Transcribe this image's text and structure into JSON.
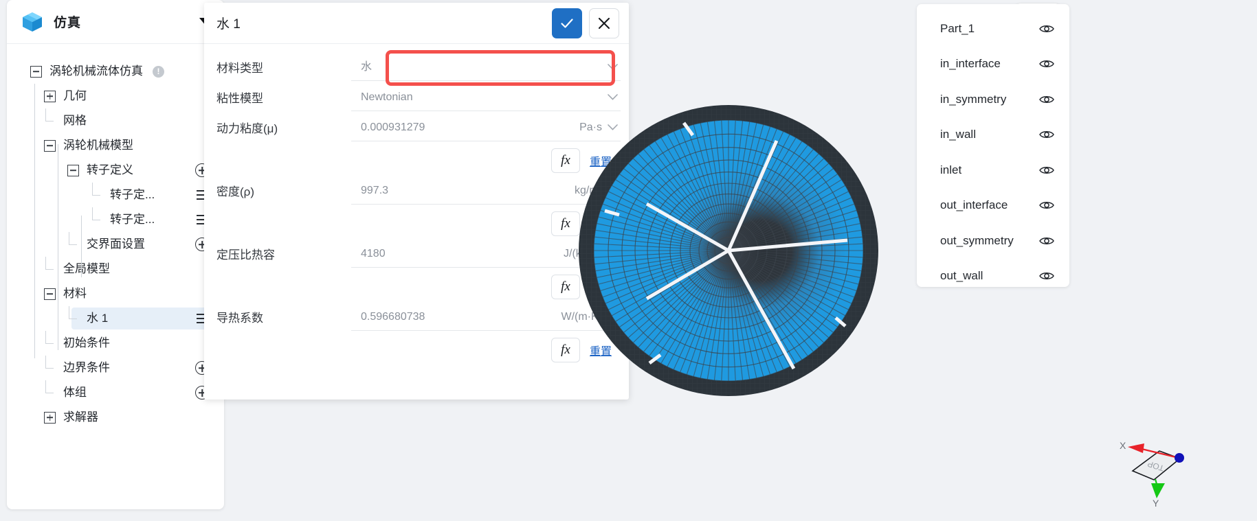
{
  "sidebar": {
    "title": "仿真",
    "logo_icon": "cube-icon",
    "collapse_icon": "chevron-down-icon",
    "tree": [
      {
        "label": "涡轮机械流体仿真",
        "depth": 0,
        "toggle": "minus",
        "badge": "!",
        "action": null,
        "selected": false
      },
      {
        "label": "几何",
        "depth": 1,
        "toggle": "plus",
        "badge": null,
        "action": null,
        "selected": false
      },
      {
        "label": "网格",
        "depth": 1,
        "toggle": "elbow",
        "badge": null,
        "action": null,
        "selected": false
      },
      {
        "label": "涡轮机械模型",
        "depth": 1,
        "toggle": "minus",
        "badge": null,
        "action": null,
        "selected": false
      },
      {
        "label": "转子定义",
        "depth": 2,
        "toggle": "minus",
        "badge": null,
        "action": "plus",
        "selected": false
      },
      {
        "label": "转子定...",
        "depth": 3,
        "toggle": "elbow",
        "badge": null,
        "action": "menu",
        "selected": false
      },
      {
        "label": "转子定...",
        "depth": 3,
        "toggle": "elbow",
        "badge": null,
        "action": "menu",
        "selected": false
      },
      {
        "label": "交界面设置",
        "depth": 2,
        "toggle": "elbow",
        "badge": null,
        "action": "plus",
        "selected": false
      },
      {
        "label": "全局模型",
        "depth": 1,
        "toggle": "elbow",
        "badge": null,
        "action": null,
        "selected": false
      },
      {
        "label": "材料",
        "depth": 1,
        "toggle": "minus",
        "badge": null,
        "action": null,
        "selected": false
      },
      {
        "label": "水 1",
        "depth": 2,
        "toggle": "elbow",
        "badge": null,
        "action": "menu",
        "selected": true
      },
      {
        "label": "初始条件",
        "depth": 1,
        "toggle": "elbow",
        "badge": null,
        "action": null,
        "selected": false
      },
      {
        "label": "边界条件",
        "depth": 1,
        "toggle": "elbow",
        "badge": null,
        "action": "plus",
        "selected": false
      },
      {
        "label": "体组",
        "depth": 1,
        "toggle": "elbow",
        "badge": null,
        "action": "plus",
        "selected": false
      },
      {
        "label": "求解器",
        "depth": 1,
        "toggle": "plus",
        "badge": null,
        "action": null,
        "selected": false
      }
    ]
  },
  "dialog": {
    "title": "水 1",
    "ok_icon": "check-icon",
    "cancel_icon": "close-icon",
    "highlight_color": "#f4504c",
    "fields": [
      {
        "label": "材料类型",
        "value": "水",
        "unit": null,
        "unit_chevron": true,
        "value_chevron": true,
        "fx": false,
        "highlighted": true
      },
      {
        "label": "粘性模型",
        "value": "Newtonian",
        "unit": null,
        "unit_chevron": true,
        "value_chevron": true,
        "fx": false,
        "highlighted": false
      },
      {
        "label": "动力粘度(μ)",
        "value": "0.000931279",
        "unit": "Pa·s",
        "unit_chevron": true,
        "value_chevron": false,
        "fx": true,
        "highlighted": false
      },
      {
        "label": "密度(ρ)",
        "value": "997.3",
        "unit": "kg/m³",
        "unit_chevron": true,
        "value_chevron": false,
        "fx": true,
        "highlighted": false
      },
      {
        "label": "定压比热容",
        "value": "4180",
        "unit": "J/(kg·K)",
        "unit_chevron": true,
        "value_chevron": false,
        "fx": true,
        "highlighted": false
      },
      {
        "label": "导热系数",
        "value": "0.596680738",
        "unit": "W/(m·K)",
        "unit_chevron": true,
        "value_chevron": false,
        "fx": true,
        "highlighted": false
      }
    ],
    "fx_label": "fx",
    "reset_label": "重置"
  },
  "viewport": {
    "refresh_icon": "refresh-icon",
    "mesh_color": "#1f9ae0",
    "mesh_line_color": "#3c444c",
    "gizmo": {
      "face_label": "TOP",
      "x_label": "X",
      "y_label": "Y",
      "x_axis_color": "#e8232a",
      "y_axis_color": "#14c814",
      "z_axis_color": "#1111b8"
    }
  },
  "parts_panel": {
    "items": [
      {
        "name": "Part_1",
        "visibility_icon": "eye-icon"
      },
      {
        "name": "in_interface",
        "visibility_icon": "eye-icon"
      },
      {
        "name": "in_symmetry",
        "visibility_icon": "eye-icon"
      },
      {
        "name": "in_wall",
        "visibility_icon": "eye-icon"
      },
      {
        "name": "inlet",
        "visibility_icon": "eye-icon"
      },
      {
        "name": "out_interface",
        "visibility_icon": "eye-icon"
      },
      {
        "name": "out_symmetry",
        "visibility_icon": "eye-icon"
      },
      {
        "name": "out_wall",
        "visibility_icon": "eye-icon"
      }
    ]
  }
}
